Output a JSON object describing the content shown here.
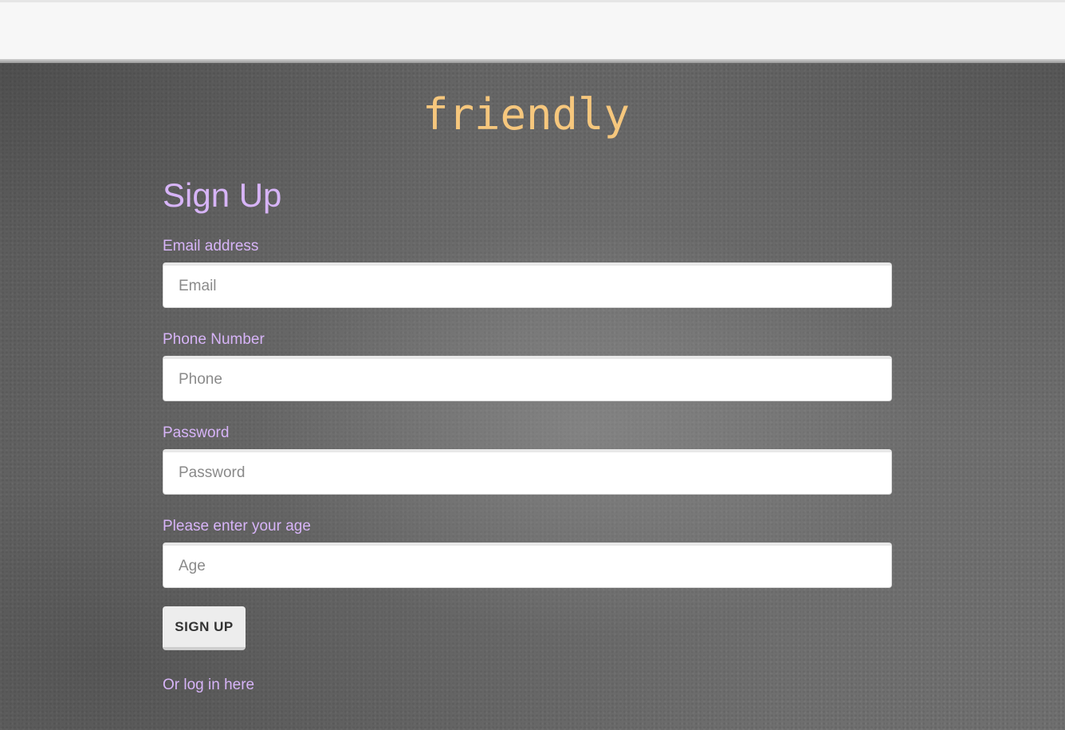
{
  "brand": {
    "name": "friendly"
  },
  "form": {
    "title": "Sign Up",
    "email": {
      "label": "Email address",
      "placeholder": "Email",
      "value": ""
    },
    "phone": {
      "label": "Phone Number",
      "placeholder": "Phone",
      "value": ""
    },
    "password": {
      "label": "Password",
      "placeholder": "Password",
      "value": ""
    },
    "age": {
      "label": "Please enter your age",
      "placeholder": "Age",
      "value": ""
    },
    "submit_label": "SIGN UP",
    "login_link": "Or log in here"
  },
  "colors": {
    "brand": "#f6c77d",
    "accent_text": "#d7b4f8",
    "background": "#6f6f6f"
  }
}
